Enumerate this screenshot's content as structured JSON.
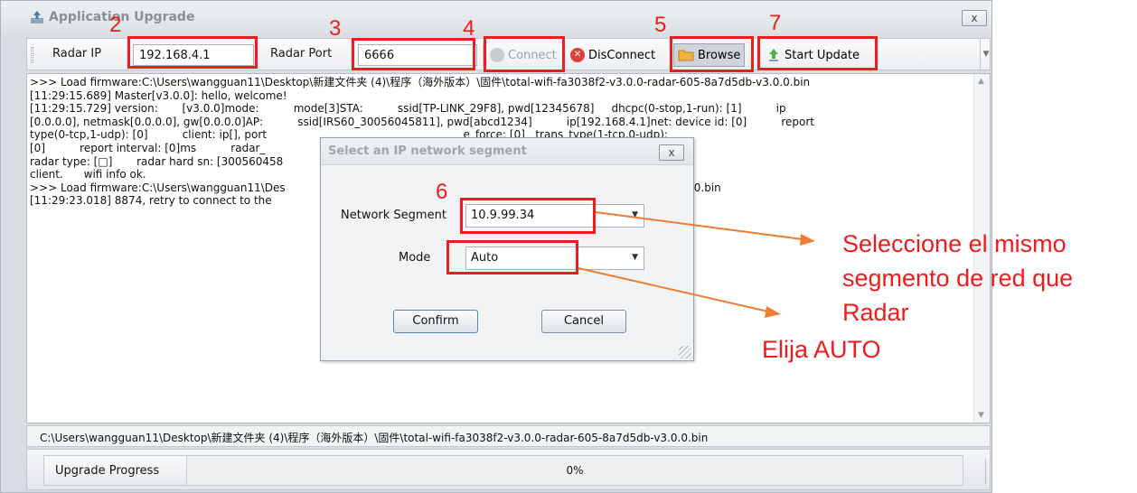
{
  "window": {
    "title": "Application Upgrade",
    "close_glyph": "x"
  },
  "toolbar": {
    "radar_ip_label": "Radar IP",
    "radar_ip_value": "192.168.4.1",
    "radar_port_label": "Radar Port",
    "radar_port_value": "6666",
    "connect_label": "Connect",
    "disconnect_label": "DisConnect",
    "browse_label": "Browse",
    "start_update_label": "Start Update"
  },
  "log": {
    "lines": [
      ">>> Load firmware:C:\\Users\\wangguan11\\Desktop\\新建文件夹 (4)\\程序（海外版本）\\固件\\total-wifi-fa3038f2-v3.0.0-radar-605-8a7d5db-v3.0.0.bin",
      "[11:29:15.689] Master[v3.0.0]: hello, welcome!",
      "[11:29:15.729] version:       [v3.0.0]mode:          mode[3]STA:          ssid[TP-LINK_29F8], pwd[12345678]     dhcpc(0-stop,1-run): [1]          ip",
      "[0.0.0.0], netmask[0.0.0.0], gw[0.0.0.0]AP:          ssid[IRS60_30056045811], pwd[abcd1234]          ip[192.168.4.1]net: device id: [0]          report",
      "type(0-tcp,1-udp): [0]          client: ip[], port                                                         e_force: [0]   trans_type(1-tcp,0-udp):",
      "[0]          report interval: [0]ms          radar_                                                          _status: [100]heap: [34832]Bytehard:",
      "radar type: [□]       radar hard sn: [300560458                                                          rent transmission service, TCP or UDP",
      "client.      wifi info ok.",
      ">>> Load firmware:C:\\Users\\wangguan11\\Des                                                                f2-v3.0.0-radar-605-8a7d5db-v3.0.0.bin",
      "[11:29:23.018] 8874, retry to connect to the"
    ]
  },
  "path": "C:\\Users\\wangguan11\\Desktop\\新建文件夹 (4)\\程序（海外版本）\\固件\\total-wifi-fa3038f2-v3.0.0-radar-605-8a7d5db-v3.0.0.bin",
  "progress": {
    "label": "Upgrade Progress",
    "value_text": "0%",
    "value_fraction": 0
  },
  "dialog": {
    "title": "Select an IP network segment",
    "close_glyph": "x",
    "segment_label": "Network Segment",
    "segment_value": "10.9.99.34",
    "mode_label": "Mode",
    "mode_value": "Auto",
    "confirm_label": "Confirm",
    "cancel_label": "Cancel"
  },
  "annotations": {
    "steps": [
      "2",
      "3",
      "4",
      "5",
      "6",
      "7"
    ],
    "note_segment": [
      "Seleccione el mismo",
      "segmento de red que",
      "Radar"
    ],
    "note_mode": "Elija AUTO",
    "highlight_color": "#ee1c1c",
    "arrow_color": "#ed7d31"
  }
}
